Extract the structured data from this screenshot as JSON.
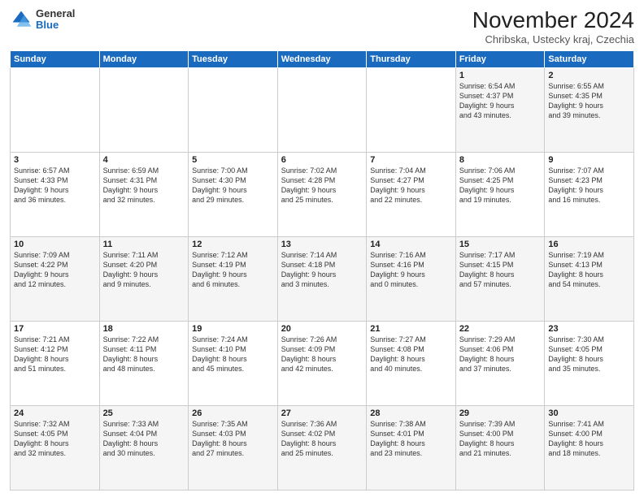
{
  "logo": {
    "general": "General",
    "blue": "Blue"
  },
  "header": {
    "month": "November 2024",
    "location": "Chribska, Ustecky kraj, Czechia"
  },
  "weekdays": [
    "Sunday",
    "Monday",
    "Tuesday",
    "Wednesday",
    "Thursday",
    "Friday",
    "Saturday"
  ],
  "weeks": [
    [
      {
        "day": "",
        "info": ""
      },
      {
        "day": "",
        "info": ""
      },
      {
        "day": "",
        "info": ""
      },
      {
        "day": "",
        "info": ""
      },
      {
        "day": "",
        "info": ""
      },
      {
        "day": "1",
        "info": "Sunrise: 6:54 AM\nSunset: 4:37 PM\nDaylight: 9 hours\nand 43 minutes."
      },
      {
        "day": "2",
        "info": "Sunrise: 6:55 AM\nSunset: 4:35 PM\nDaylight: 9 hours\nand 39 minutes."
      }
    ],
    [
      {
        "day": "3",
        "info": "Sunrise: 6:57 AM\nSunset: 4:33 PM\nDaylight: 9 hours\nand 36 minutes."
      },
      {
        "day": "4",
        "info": "Sunrise: 6:59 AM\nSunset: 4:31 PM\nDaylight: 9 hours\nand 32 minutes."
      },
      {
        "day": "5",
        "info": "Sunrise: 7:00 AM\nSunset: 4:30 PM\nDaylight: 9 hours\nand 29 minutes."
      },
      {
        "day": "6",
        "info": "Sunrise: 7:02 AM\nSunset: 4:28 PM\nDaylight: 9 hours\nand 25 minutes."
      },
      {
        "day": "7",
        "info": "Sunrise: 7:04 AM\nSunset: 4:27 PM\nDaylight: 9 hours\nand 22 minutes."
      },
      {
        "day": "8",
        "info": "Sunrise: 7:06 AM\nSunset: 4:25 PM\nDaylight: 9 hours\nand 19 minutes."
      },
      {
        "day": "9",
        "info": "Sunrise: 7:07 AM\nSunset: 4:23 PM\nDaylight: 9 hours\nand 16 minutes."
      }
    ],
    [
      {
        "day": "10",
        "info": "Sunrise: 7:09 AM\nSunset: 4:22 PM\nDaylight: 9 hours\nand 12 minutes."
      },
      {
        "day": "11",
        "info": "Sunrise: 7:11 AM\nSunset: 4:20 PM\nDaylight: 9 hours\nand 9 minutes."
      },
      {
        "day": "12",
        "info": "Sunrise: 7:12 AM\nSunset: 4:19 PM\nDaylight: 9 hours\nand 6 minutes."
      },
      {
        "day": "13",
        "info": "Sunrise: 7:14 AM\nSunset: 4:18 PM\nDaylight: 9 hours\nand 3 minutes."
      },
      {
        "day": "14",
        "info": "Sunrise: 7:16 AM\nSunset: 4:16 PM\nDaylight: 9 hours\nand 0 minutes."
      },
      {
        "day": "15",
        "info": "Sunrise: 7:17 AM\nSunset: 4:15 PM\nDaylight: 8 hours\nand 57 minutes."
      },
      {
        "day": "16",
        "info": "Sunrise: 7:19 AM\nSunset: 4:13 PM\nDaylight: 8 hours\nand 54 minutes."
      }
    ],
    [
      {
        "day": "17",
        "info": "Sunrise: 7:21 AM\nSunset: 4:12 PM\nDaylight: 8 hours\nand 51 minutes."
      },
      {
        "day": "18",
        "info": "Sunrise: 7:22 AM\nSunset: 4:11 PM\nDaylight: 8 hours\nand 48 minutes."
      },
      {
        "day": "19",
        "info": "Sunrise: 7:24 AM\nSunset: 4:10 PM\nDaylight: 8 hours\nand 45 minutes."
      },
      {
        "day": "20",
        "info": "Sunrise: 7:26 AM\nSunset: 4:09 PM\nDaylight: 8 hours\nand 42 minutes."
      },
      {
        "day": "21",
        "info": "Sunrise: 7:27 AM\nSunset: 4:08 PM\nDaylight: 8 hours\nand 40 minutes."
      },
      {
        "day": "22",
        "info": "Sunrise: 7:29 AM\nSunset: 4:06 PM\nDaylight: 8 hours\nand 37 minutes."
      },
      {
        "day": "23",
        "info": "Sunrise: 7:30 AM\nSunset: 4:05 PM\nDaylight: 8 hours\nand 35 minutes."
      }
    ],
    [
      {
        "day": "24",
        "info": "Sunrise: 7:32 AM\nSunset: 4:05 PM\nDaylight: 8 hours\nand 32 minutes."
      },
      {
        "day": "25",
        "info": "Sunrise: 7:33 AM\nSunset: 4:04 PM\nDaylight: 8 hours\nand 30 minutes."
      },
      {
        "day": "26",
        "info": "Sunrise: 7:35 AM\nSunset: 4:03 PM\nDaylight: 8 hours\nand 27 minutes."
      },
      {
        "day": "27",
        "info": "Sunrise: 7:36 AM\nSunset: 4:02 PM\nDaylight: 8 hours\nand 25 minutes."
      },
      {
        "day": "28",
        "info": "Sunrise: 7:38 AM\nSunset: 4:01 PM\nDaylight: 8 hours\nand 23 minutes."
      },
      {
        "day": "29",
        "info": "Sunrise: 7:39 AM\nSunset: 4:00 PM\nDaylight: 8 hours\nand 21 minutes."
      },
      {
        "day": "30",
        "info": "Sunrise: 7:41 AM\nSunset: 4:00 PM\nDaylight: 8 hours\nand 18 minutes."
      }
    ]
  ]
}
